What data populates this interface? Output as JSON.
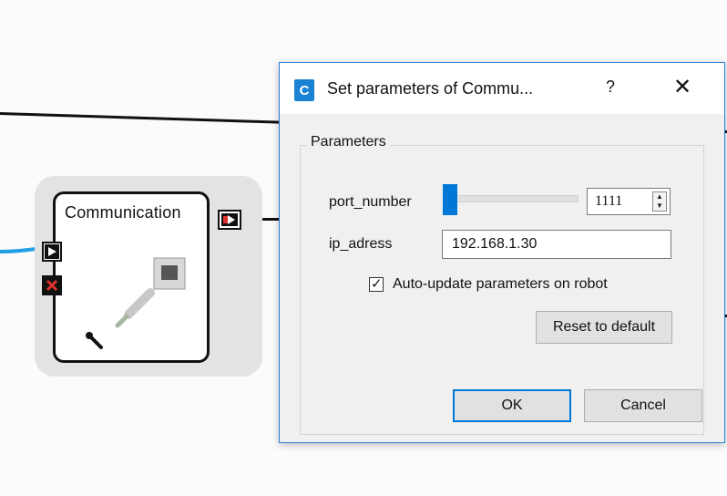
{
  "block": {
    "title": "Communication"
  },
  "dialog": {
    "app_icon_letter": "C",
    "title": "Set parameters of Commu...",
    "help_label": "?",
    "close_label": "✕",
    "group_label": "Parameters",
    "port_number": {
      "label": "port_number",
      "value": "1111",
      "slider_fraction": 0.02
    },
    "ip_adress": {
      "label": "ip_adress",
      "value": "192.168.1.30"
    },
    "auto_update": {
      "label": "Auto-update parameters on robot",
      "checked": true
    },
    "reset_label": "Reset to default",
    "ok_label": "OK",
    "cancel_label": "Cancel"
  },
  "colors": {
    "accent": "#0078d7",
    "wire_blue": "#1f9fe4",
    "stop_red": "#e0322d"
  },
  "icons": [
    "play-triangle-icon",
    "stop-x-icon",
    "output-port-icon",
    "ethernet-cable-icon",
    "wrench-icon"
  ]
}
